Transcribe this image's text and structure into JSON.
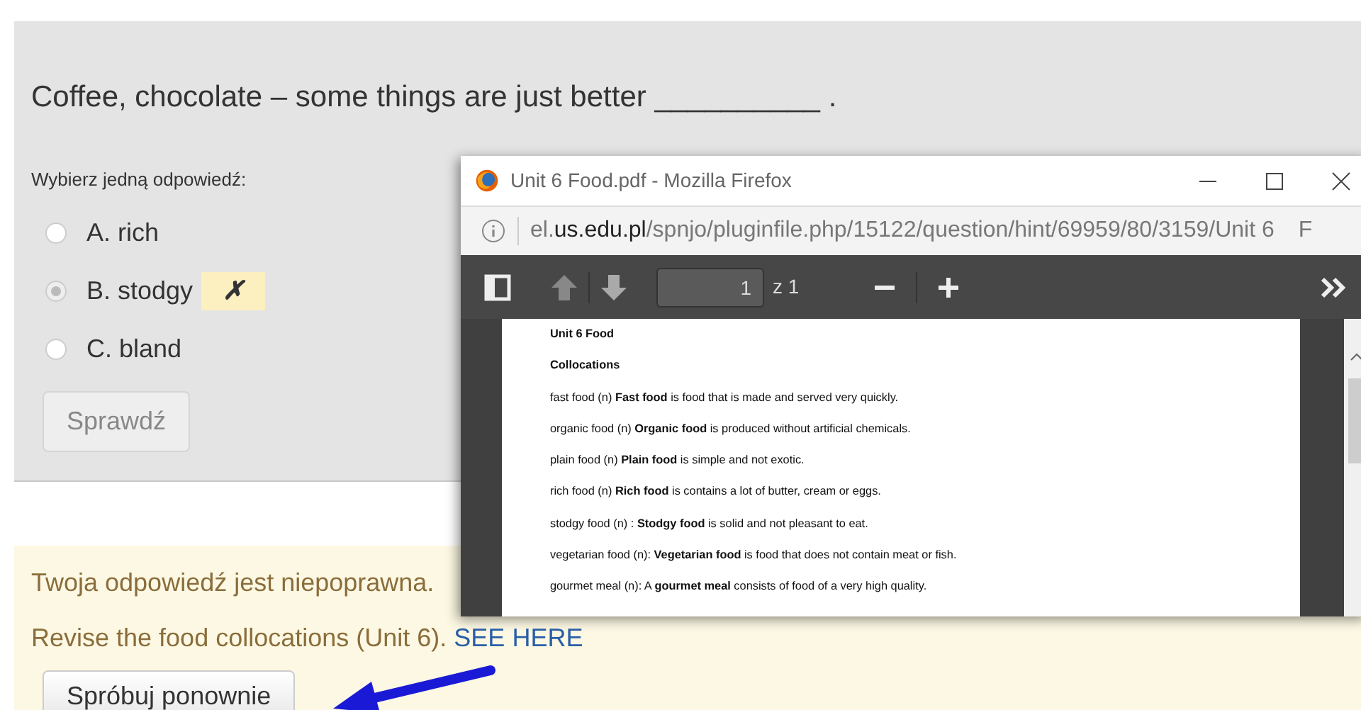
{
  "question": {
    "text": "Coffee, chocolate – some things are just better __________ .",
    "prompt": "Wybierz jedną odpowiedź:",
    "options": [
      {
        "label": "A. rich",
        "selected": false
      },
      {
        "label": "B. stodgy",
        "selected": true,
        "mark": "✗"
      },
      {
        "label": "C. bland",
        "selected": false
      }
    ],
    "check_button": {
      "label": "Sprawdź",
      "disabled": true
    }
  },
  "feedback": {
    "status": "Twoja odpowiedź jest niepoprawna.",
    "hint": "Revise the food collocations (Unit 6).",
    "link": "SEE HERE",
    "retry_button": "Spróbuj ponownie"
  },
  "popup": {
    "title": "Unit 6 Food.pdf - Mozilla Firefox",
    "url_prefix": "el.",
    "url_domain": "us.edu.pl",
    "url_path": "/spnjo/pluginfile.php/15122/question/hint/69959/80/3159/Unit 6",
    "url_tail": "F",
    "page": "1",
    "page_count": "z 1",
    "pdf_lines": [
      {
        "text": "Unit 6   Food",
        "kind": "heading"
      },
      {
        "text": "Collocations",
        "kind": "heading"
      },
      {
        "text": "fast food (n) **Fast food** is food that is made and served very quickly.",
        "kind": "entry"
      },
      {
        "text": "organic food (n) **Organic food** is produced without artificial chemicals.",
        "kind": "entry"
      },
      {
        "text": "plain food (n) **Plain food** is simple and not exotic.",
        "kind": "entry"
      },
      {
        "text": "rich food (n) **Rich food** is contains a lot of butter, cream or eggs.",
        "kind": "entry"
      },
      {
        "text": "stodgy food (n) : **Stodgy food** is solid and not pleasant to eat.",
        "kind": "entry"
      },
      {
        "text": "vegetarian food (n):  **Vegetarian food** is food that does not contain meat or fish.",
        "kind": "entry"
      },
      {
        "text": "gourmet meal (n): A **gourmet meal** consists of food of a very high quality.",
        "kind": "entry"
      }
    ]
  }
}
